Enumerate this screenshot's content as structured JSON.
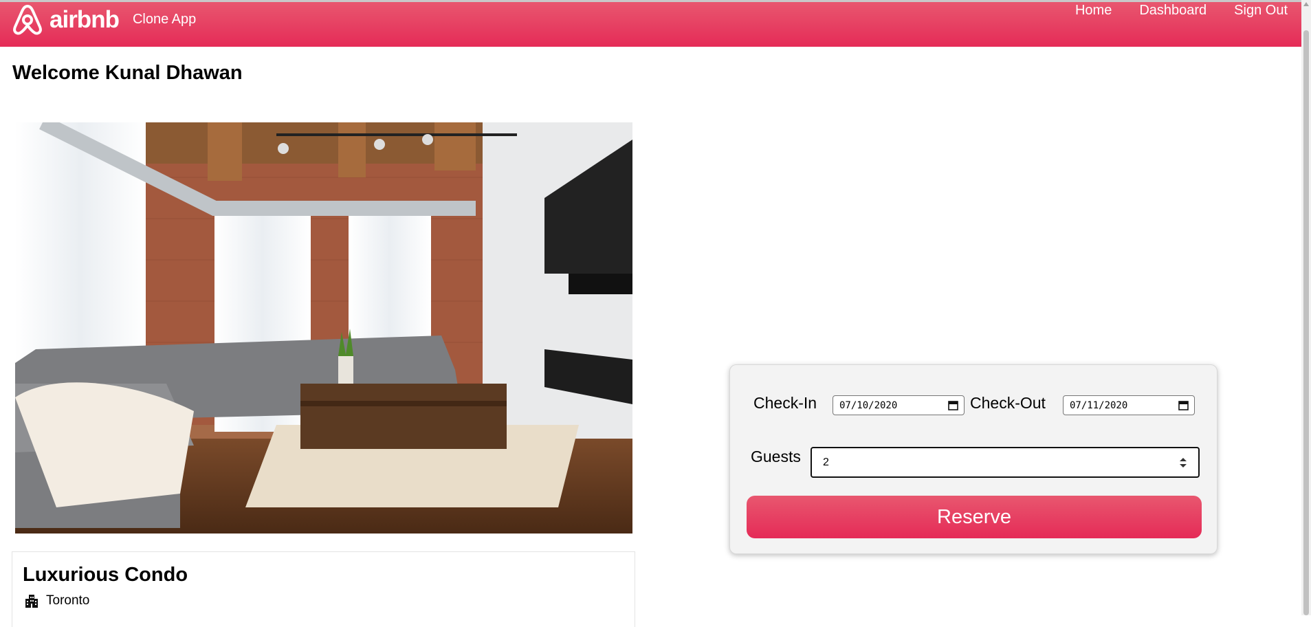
{
  "header": {
    "brand_name": "airbnb",
    "brand_sub": "Clone App",
    "nav": [
      "Home",
      "Dashboard",
      "Sign Out"
    ],
    "brand_color": "#e52b57"
  },
  "welcome": "Welcome Kunal Dhawan",
  "listing": {
    "title": "Luxurious Condo",
    "location": "Toronto",
    "location_icon": "city-buildings-icon"
  },
  "booking": {
    "checkin_label": "Check-In",
    "checkin_value": "07/10/2020",
    "checkout_label": "Check-Out",
    "checkout_value": "07/11/2020",
    "guests_label": "Guests",
    "guests_value": "2",
    "reserve_label": "Reserve"
  }
}
